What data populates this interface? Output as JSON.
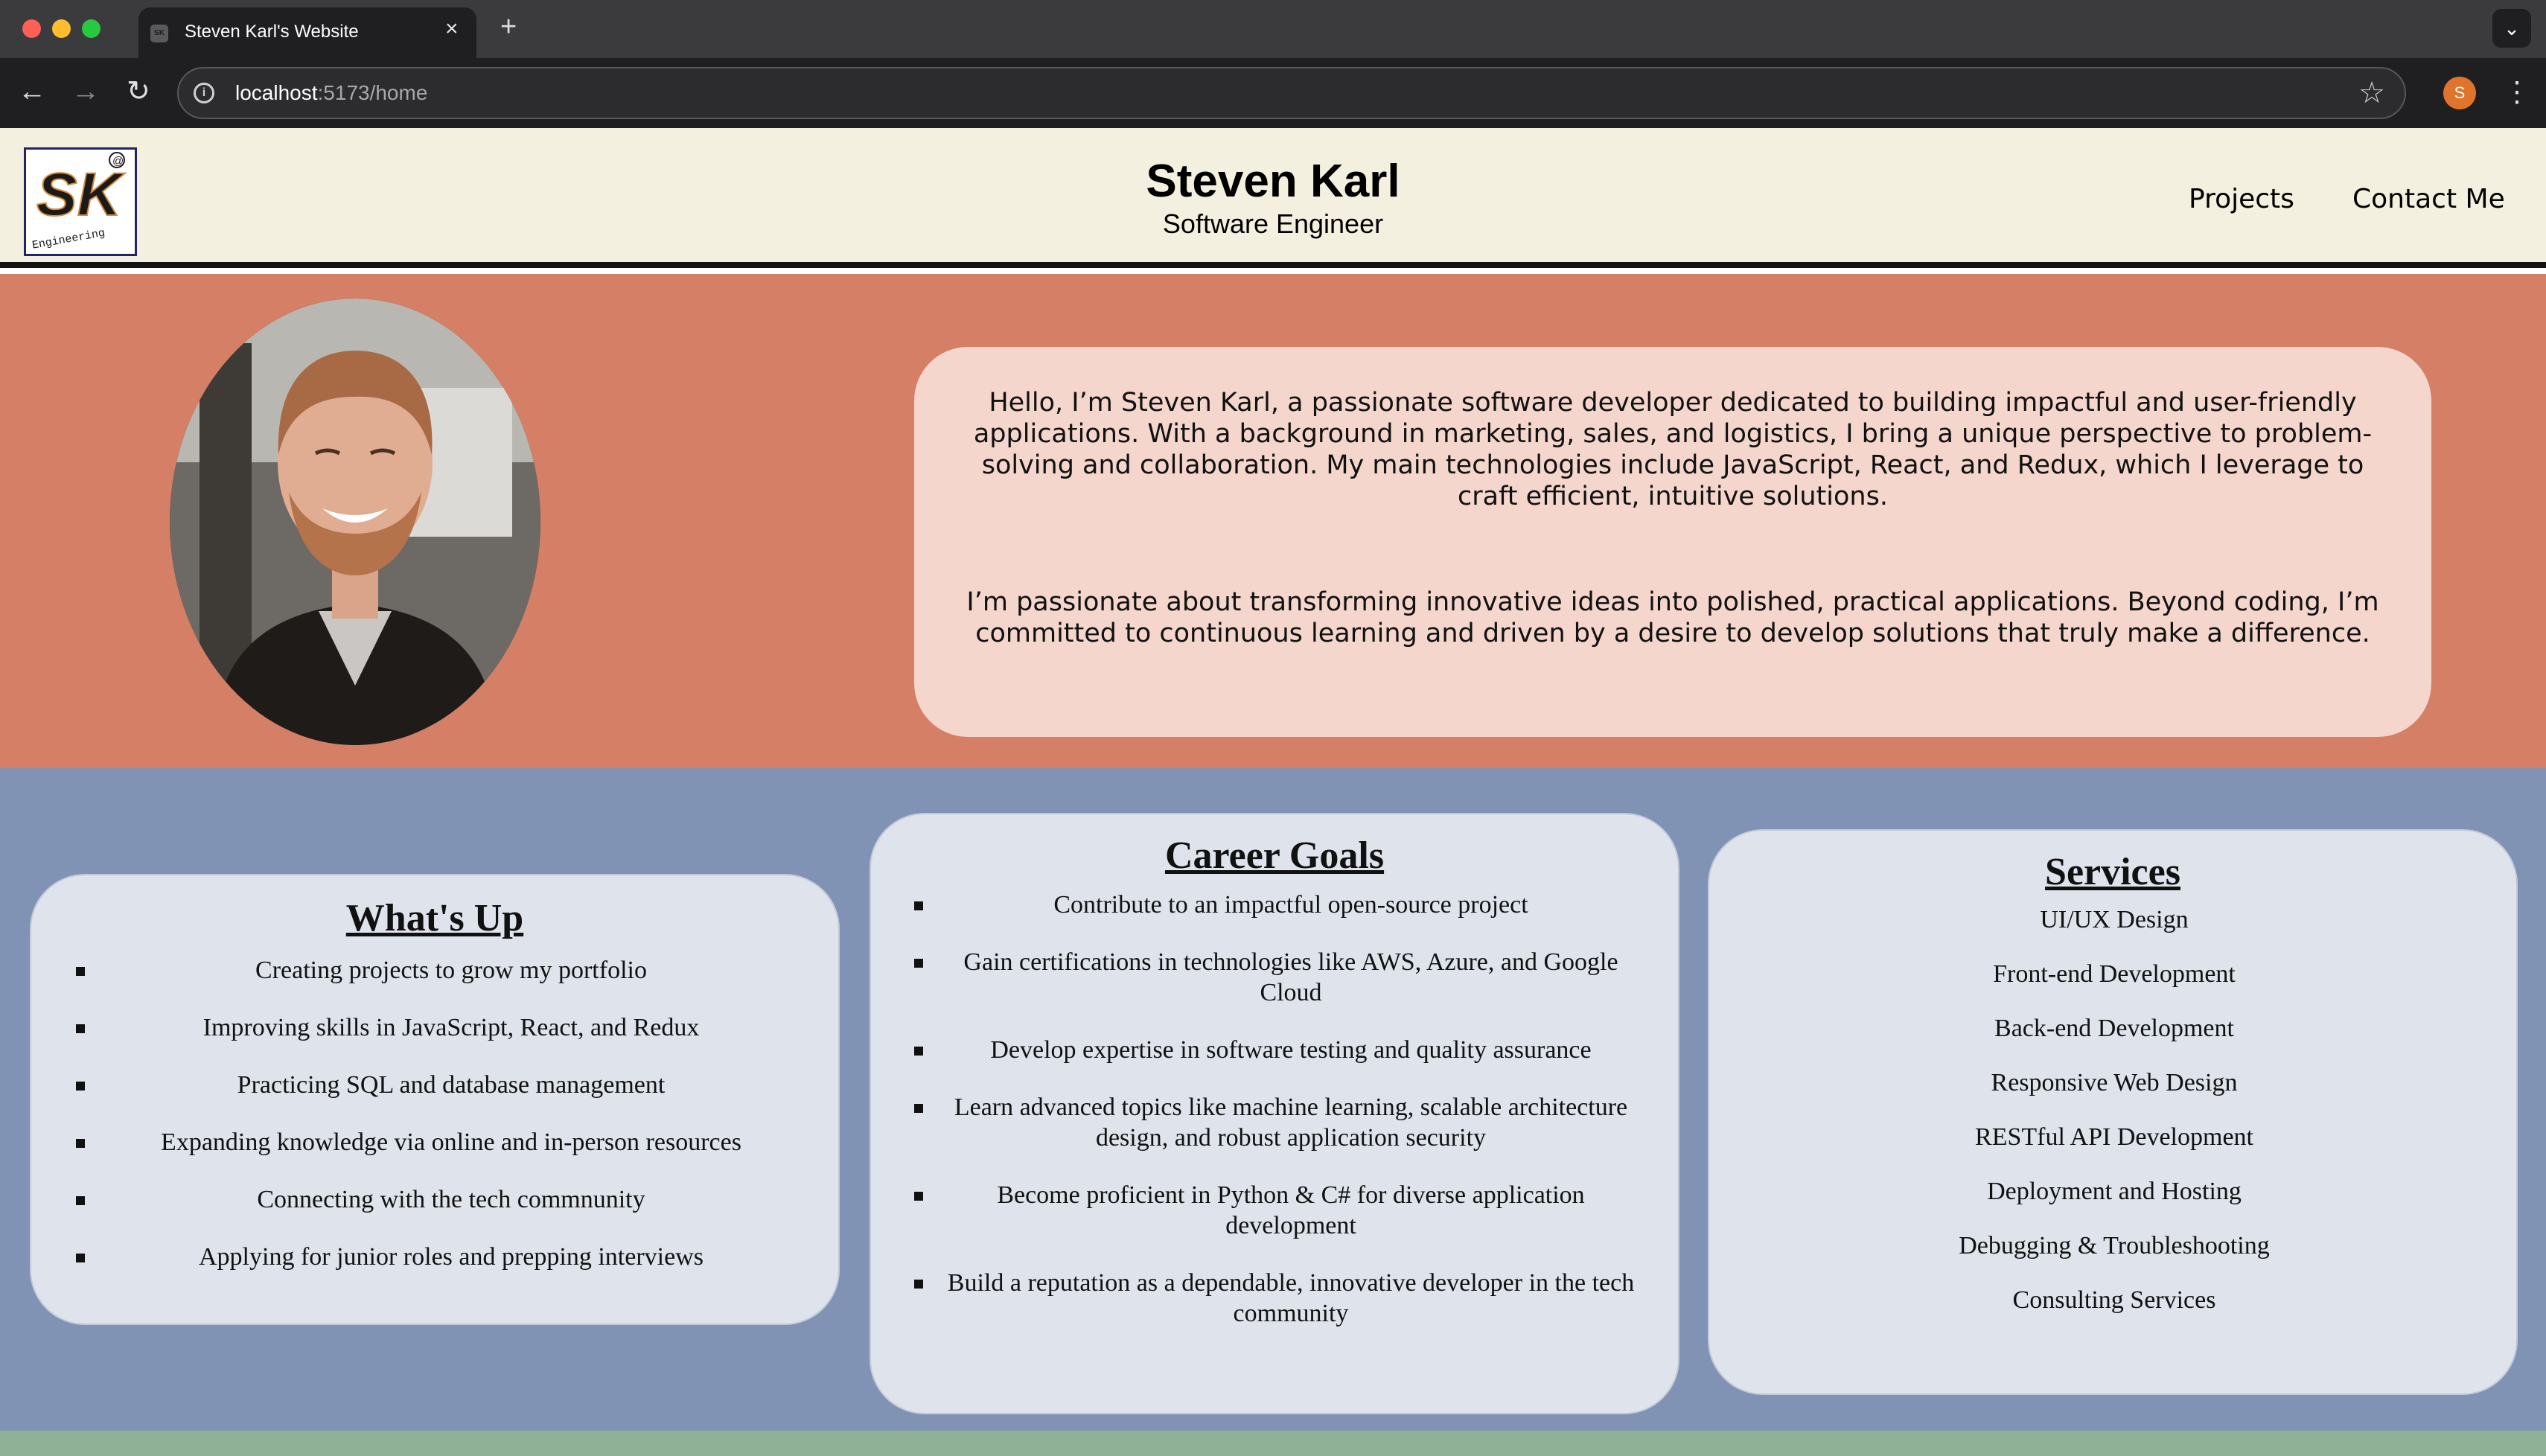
{
  "browser": {
    "tab_title": "Steven Karl's Website",
    "tab_favicon_text": "SK",
    "tab_close_icon": "×",
    "new_tab_icon": "+",
    "tabs_menu_icon": "⌄",
    "url_host": "localhost",
    "url_path": ":5173/home",
    "profile_initial": "S",
    "back_icon": "←",
    "forward_icon": "→",
    "reload_icon": "↻",
    "star_icon": "☆",
    "menu_icon": "⋮",
    "traffic_colors": [
      "#fe5f57",
      "#febc2e",
      "#28c840"
    ]
  },
  "header": {
    "name": "Steven Karl",
    "role": "Software Engineer",
    "logo_text": "SK",
    "logo_subtext": "Engineering",
    "logo_at": "@",
    "nav": [
      "Projects",
      "Contact Me"
    ]
  },
  "intro": {
    "paragraph_1": "Hello, I’m Steven Karl, a passionate software developer dedicated to building impactful and user-friendly applications. With a background in marketing, sales, and logistics, I bring a unique perspective to problem-solving and collaboration. My main technologies include JavaScript, React, and Redux, which I leverage to craft efficient, intuitive solutions.",
    "paragraph_2": "I’m passionate about transforming innovative ideas into polished, practical applications. Beyond coding, I’m committed to continuous learning and driven by a desire to develop solutions that truly make a difference."
  },
  "whats_up": {
    "title": "What's Up",
    "items": [
      "Creating projects to grow my portfolio",
      "Improving skills in JavaScript, React, and Redux",
      "Practicing SQL and database management",
      "Expanding knowledge via online and in-person resources",
      "Connecting with the tech commnunity",
      "Applying for junior roles and prepping interviews"
    ]
  },
  "career_goals": {
    "title": "Career Goals",
    "items": [
      "Contribute to an impactful open-source project",
      "Gain certifications in technologies like AWS, Azure, and Google Cloud",
      "Develop expertise in software testing and quality assurance",
      "Learn advanced topics like machine learning, scalable architecture design, and robust application security",
      "Become proficient in Python & C# for diverse application development",
      "Build a reputation as a dependable, innovative developer in the tech community"
    ]
  },
  "services": {
    "title": "Services",
    "items": [
      "UI/UX Design",
      "Front-end Development",
      "Back-end Development",
      "Responsive Web Design",
      "RESTful API Development",
      "Deployment and Hosting",
      "Debugging & Troubleshooting",
      "Consulting Services"
    ]
  },
  "colors": {
    "header_bg": "#f3f0df",
    "intro_bg": "#d47f66",
    "bio_card_bg": "#f4d6cc",
    "cards_band_bg": "#8193b4",
    "card_bg": "#dee3ec",
    "footer_strip": "#8fb296"
  }
}
